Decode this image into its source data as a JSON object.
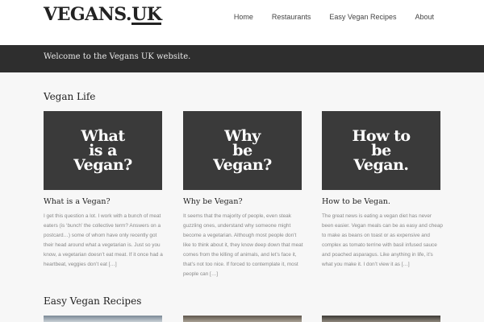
{
  "site": {
    "logo_main": "VEGANS.",
    "logo_tld": "UK"
  },
  "nav": {
    "items": [
      "Home",
      "Restaurants",
      "Easy Vegan Recipes",
      "About"
    ]
  },
  "banner": {
    "text": "Welcome to the Vegans UK website."
  },
  "sections": {
    "vegan_life": "Vegan Life",
    "easy_recipes": "Easy Vegan Recipes"
  },
  "cards": [
    {
      "image_lines": [
        "What",
        "is a",
        "Vegan?"
      ],
      "title": "What is a Vegan?",
      "excerpt": "I get this question a lot. I work with a bunch of meat eaters (is ‘bunch’ the collective term? Answers on a postcard…) some of whom have only recently got their head around what a vegetarian is. Just so you know, a vegetarian doesn’t eat meat. If it once had a heartbeat, veggies don’t eat […]"
    },
    {
      "image_lines": [
        "Why",
        "be",
        "Vegan?"
      ],
      "title": "Why be Vegan?",
      "excerpt": "It seems that the majority of people, even steak guzzling ones, understand why someone might become a vegetarian. Although most people don’t like to think about it, they know deep down that meat comes from the killing of animals, and let’s face it, that’s not too nice. If forced to contemplate it, most people can […]"
    },
    {
      "image_lines": [
        "How to",
        "be",
        "Vegan."
      ],
      "title": "How to be Vegan.",
      "excerpt": "The great news is eating a vegan diet has never been easier. Vegan meals can be as easy and cheap to make as beans on toast or as expensive and complex as tomato terrine with basil infused sauce and poached asparagus. Like anything in life, it’s what you make it. I don’t view it as […]"
    }
  ],
  "colors": {
    "banner_bg": "#2e2e2e",
    "card_bg": "#3a3a3a",
    "page_bg": "#f7f7f7"
  }
}
